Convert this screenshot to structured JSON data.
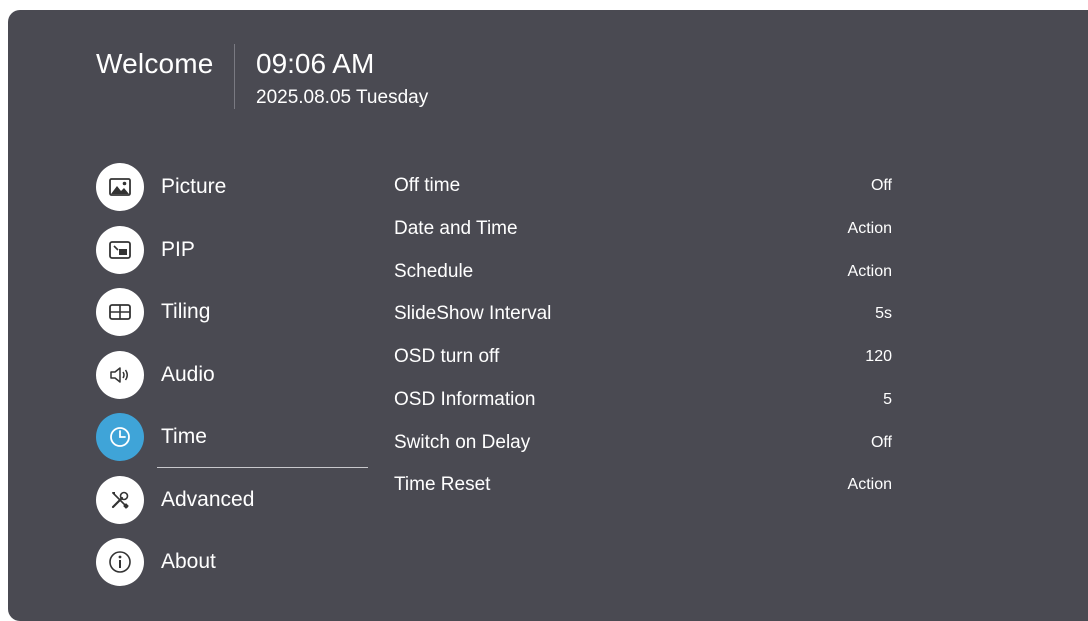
{
  "header": {
    "welcome": "Welcome",
    "time": "09:06 AM",
    "date": "2025.08.05 Tuesday"
  },
  "menu": {
    "items": [
      {
        "label": "Picture",
        "icon": "picture-icon"
      },
      {
        "label": "PIP",
        "icon": "pip-icon"
      },
      {
        "label": "Tiling",
        "icon": "tiling-icon"
      },
      {
        "label": "Audio",
        "icon": "speaker-icon"
      },
      {
        "label": "Time",
        "icon": "clock-icon",
        "selected": true
      },
      {
        "label": "Advanced",
        "icon": "tools-icon"
      },
      {
        "label": "About",
        "icon": "info-icon"
      }
    ]
  },
  "settings": {
    "rows": [
      {
        "label": "Off time",
        "value": "Off"
      },
      {
        "label": "Date and Time",
        "value": "Action"
      },
      {
        "label": "Schedule",
        "value": "Action"
      },
      {
        "label": "SlideShow Interval",
        "value": "5s"
      },
      {
        "label": "OSD turn off",
        "value": "120"
      },
      {
        "label": "OSD Information",
        "value": "5"
      },
      {
        "label": "Switch on Delay",
        "value": "Off"
      },
      {
        "label": "Time Reset",
        "value": "Action"
      }
    ]
  },
  "colors": {
    "panel_background": "#4a4a52",
    "accent": "#3fa4d8",
    "icon_background": "#ffffff",
    "text": "#ffffff"
  }
}
